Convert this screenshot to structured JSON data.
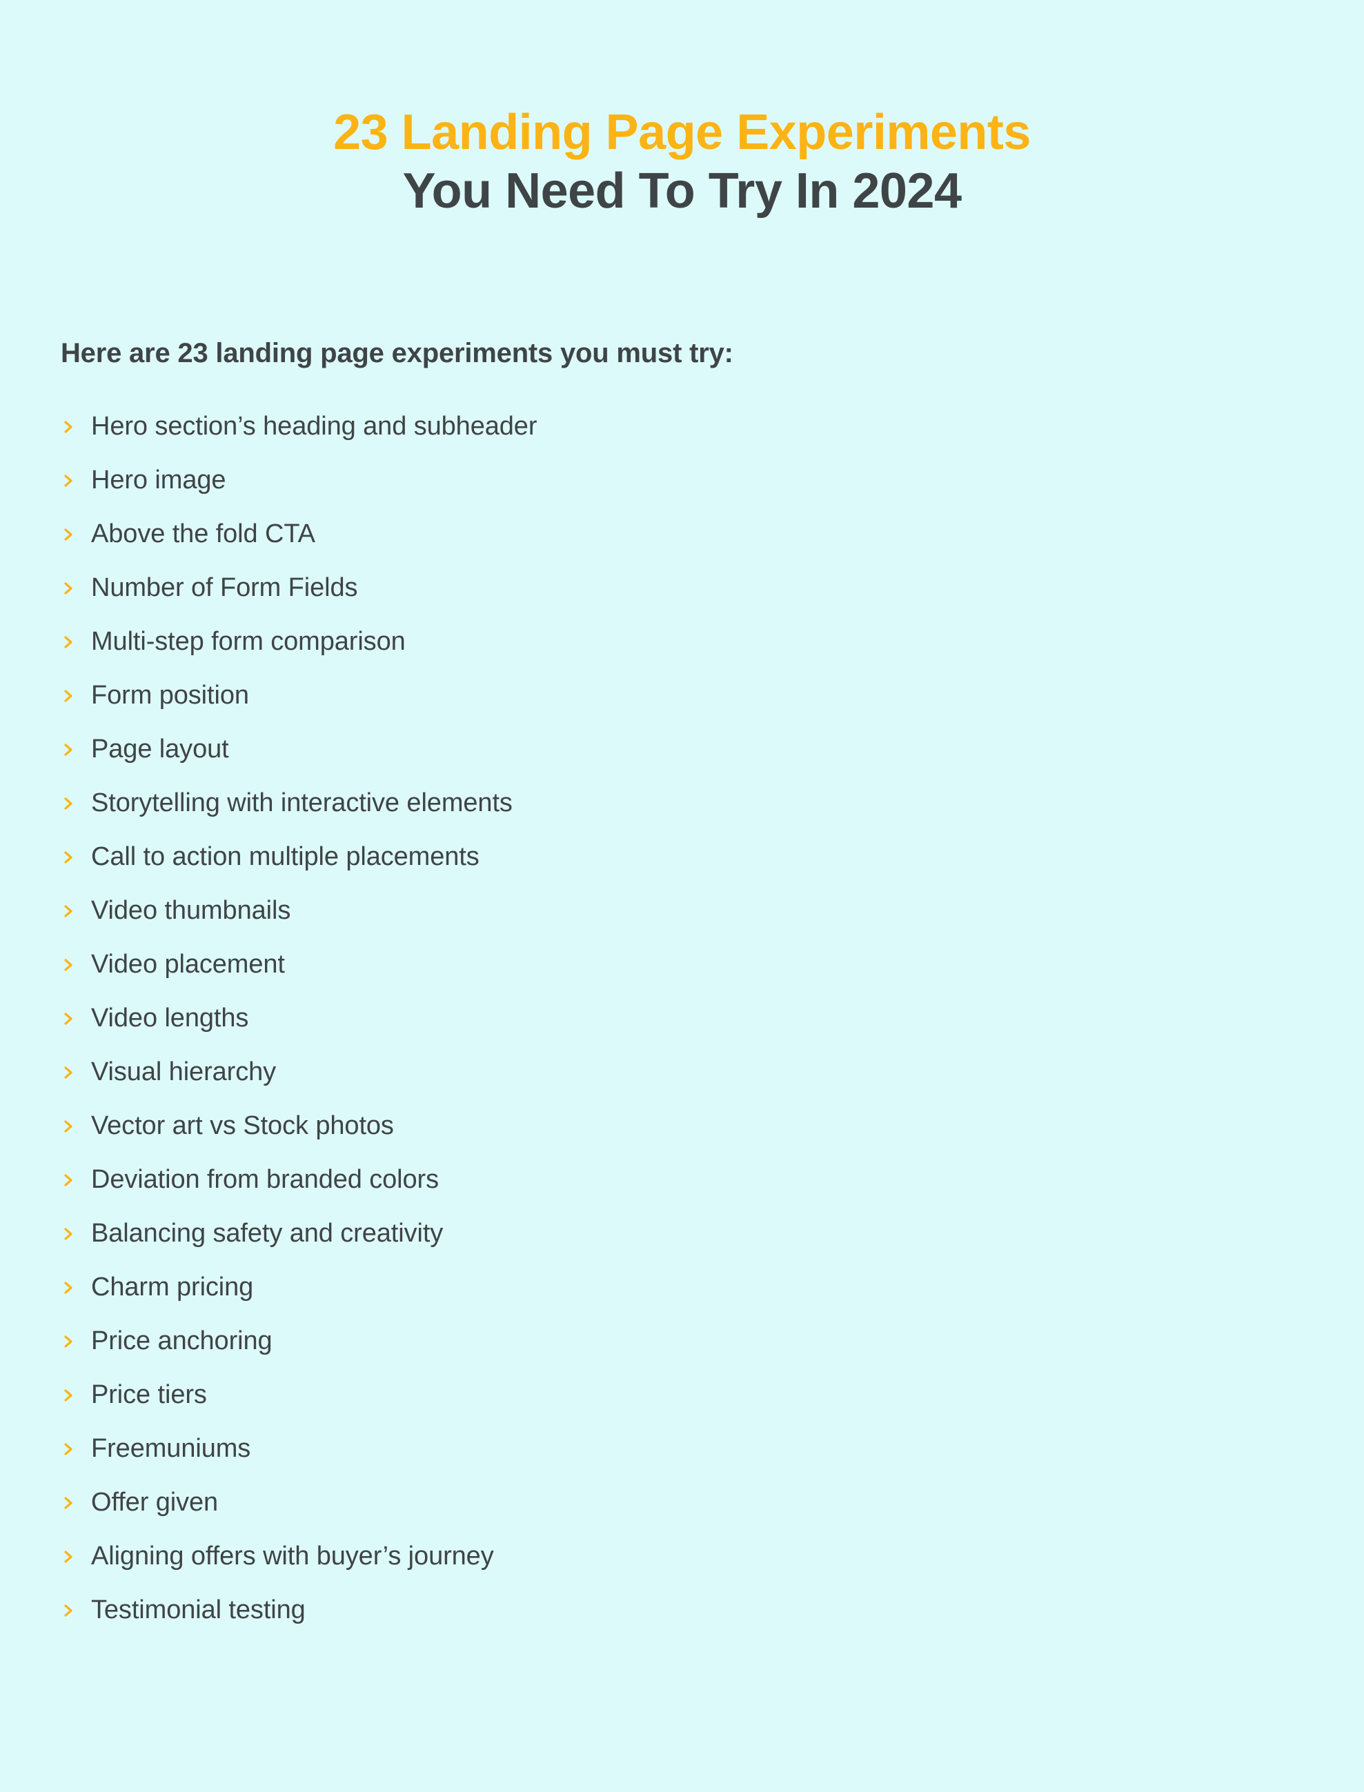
{
  "page": {
    "background_color": "#ddfafa",
    "accent_color": "#fbb315",
    "text_color": "#3f4446"
  },
  "title": {
    "line1": "23 Landing Page Experiments",
    "line2": "You Need To Try In 2024"
  },
  "intro": "Here are 23 landing page experiments you must try:",
  "bullet_icon": "chevron-right-icon",
  "experiments": [
    "Hero section’s heading and subheader",
    "Hero image",
    "Above the fold CTA",
    "Number of Form Fields",
    "Multi-step form comparison",
    "Form position",
    "Page layout",
    "Storytelling with interactive elements",
    "Call to action multiple placements",
    "Video thumbnails",
    "Video placement",
    "Video lengths",
    "Visual hierarchy",
    "Vector art vs Stock photos",
    "Deviation from branded colors",
    "Balancing safety and creativity",
    "Charm pricing",
    "Price anchoring",
    "Price tiers",
    "Freemuniums",
    "Offer given",
    "Aligning offers with buyer’s journey",
    "Testimonial testing"
  ]
}
